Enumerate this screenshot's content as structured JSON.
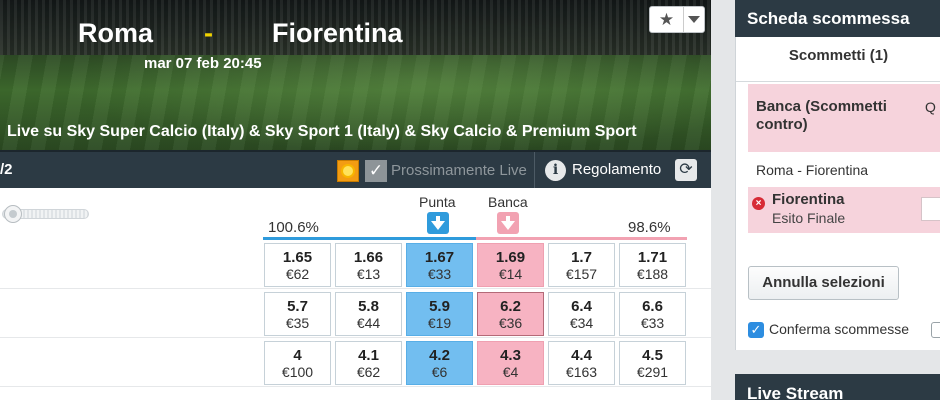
{
  "header": {
    "home_team": "Roma",
    "separator": "-",
    "away_team": "Fiorentina",
    "date": "mar 07 feb 20:45",
    "live_text": "Live su Sky Super Calcio (Italy) & Sky Sport 1 (Italy) & Sky Calcio & Premium Sport",
    "favorite_icon": "star-icon"
  },
  "toolbar": {
    "market_fragment": "/2",
    "soon_live_label": "Prossimamente Live",
    "rules_label": "Regolamento",
    "info_glyph": "i",
    "refresh_glyph": "⟳"
  },
  "market": {
    "back_label": "Punta",
    "lay_label": "Banca",
    "back_overround": "100.6%",
    "lay_overround": "98.6%",
    "rows": [
      {
        "cells": [
          {
            "odd": "1.65",
            "vol": "€62"
          },
          {
            "odd": "1.66",
            "vol": "€13"
          },
          {
            "odd": "1.67",
            "vol": "€33"
          },
          {
            "odd": "1.69",
            "vol": "€14"
          },
          {
            "odd": "1.7",
            "vol": "€157"
          },
          {
            "odd": "1.71",
            "vol": "€188"
          }
        ]
      },
      {
        "cells": [
          {
            "odd": "5.7",
            "vol": "€35"
          },
          {
            "odd": "5.8",
            "vol": "€44"
          },
          {
            "odd": "5.9",
            "vol": "€19"
          },
          {
            "odd": "6.2",
            "vol": "€36"
          },
          {
            "odd": "6.4",
            "vol": "€34"
          },
          {
            "odd": "6.6",
            "vol": "€33"
          }
        ]
      },
      {
        "cells": [
          {
            "odd": "4",
            "vol": "€100"
          },
          {
            "odd": "4.1",
            "vol": "€62"
          },
          {
            "odd": "4.2",
            "vol": "€6"
          },
          {
            "odd": "4.3",
            "vol": "€4"
          },
          {
            "odd": "4.4",
            "vol": "€163"
          },
          {
            "odd": "4.5",
            "vol": "€291"
          }
        ]
      }
    ]
  },
  "betslip": {
    "title": "Scheda scommessa",
    "tab_label": "Scommetti (1)",
    "lay_header": "Banca (Scommetti contro)",
    "lay_col": "Q sco",
    "event": "Roma - Fiorentina",
    "selection": "Fiorentina",
    "selection_market": "Esito Finale",
    "cancel_label": "Annulla selezioni",
    "confirm_label": "Conferma scommesse",
    "confirm_checked": true
  },
  "live_stream": {
    "title": "Live Stream"
  },
  "colors": {
    "back": "#72bef0",
    "lay": "#f7b3c2",
    "dark_bar": "#2c3a44",
    "accent_separator": "#f0d200"
  }
}
